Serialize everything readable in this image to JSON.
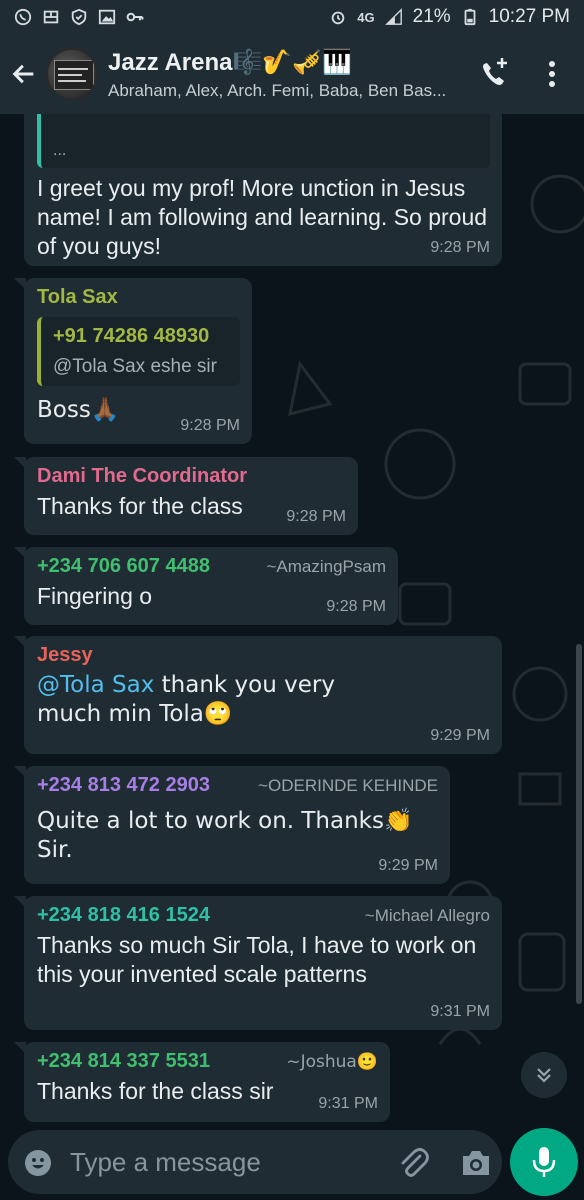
{
  "status_bar": {
    "network": "4G",
    "battery": "21%",
    "time": "10:27 PM"
  },
  "header": {
    "title": "Jazz Arena🎼🎷🎺🎹",
    "subtitle": "Abraham, Alex, Arch. Femi, Baba, Ben Bas..."
  },
  "messages": [
    {
      "quote_ellipsis": "...",
      "text": "I greet you my prof! More unction in Jesus name! I am following and learning. So proud of you guys!",
      "time": "9:28 PM"
    },
    {
      "sender": "Tola Sax",
      "sender_color": "#a3b843",
      "quote": {
        "name": "+91 74286 48930",
        "text": "@Tola Sax  eshe sir"
      },
      "text": "Boss🙏🏾",
      "time": "9:28 PM"
    },
    {
      "sender": "Dami The Coordinator",
      "sender_color": "#e26b8d",
      "text": "Thanks for the class",
      "time": "9:28 PM"
    },
    {
      "sender": "+234 706 607 4488",
      "sender_color": "#3fbf6f",
      "pushname": "~AmazingPsam",
      "text": "Fingering o",
      "time": "9:28 PM"
    },
    {
      "sender": "Jessy",
      "sender_color": "#e8635a",
      "mention": "@Tola Sax",
      "text_after_mention": " thank you very much min Tola🙄",
      "time": "9:29 PM"
    },
    {
      "sender": "+234 813 472 2903",
      "sender_color": "#a77ee6",
      "pushname": "~ODERINDE KEHINDE",
      "text": "Quite a lot to work on. Thanks👏 Sir.",
      "time": "9:29 PM"
    },
    {
      "sender": "+234 818 416 1524",
      "sender_color": "#2fc0a6",
      "pushname": "~Michael Allegro",
      "text": "Thanks so much Sir Tola, I have to work on this your invented scale patterns",
      "time": "9:31 PM"
    },
    {
      "sender": "+234 814 337 5531",
      "sender_color": "#3fbf6f",
      "pushname": "~Joshua🙂",
      "text": "Thanks for the class sir",
      "time": "9:31 PM"
    }
  ],
  "input": {
    "placeholder": "Type a message"
  },
  "icons": [
    "whatsapp-icon",
    "gallery-icon",
    "shield-icon",
    "image-icon",
    "key-icon",
    "signal-icon",
    "battery-icon",
    "back-arrow-icon",
    "add-call-icon",
    "more-vert-icon",
    "chevron-down-icon",
    "emoji-icon",
    "attach-icon",
    "camera-icon",
    "mic-icon"
  ]
}
